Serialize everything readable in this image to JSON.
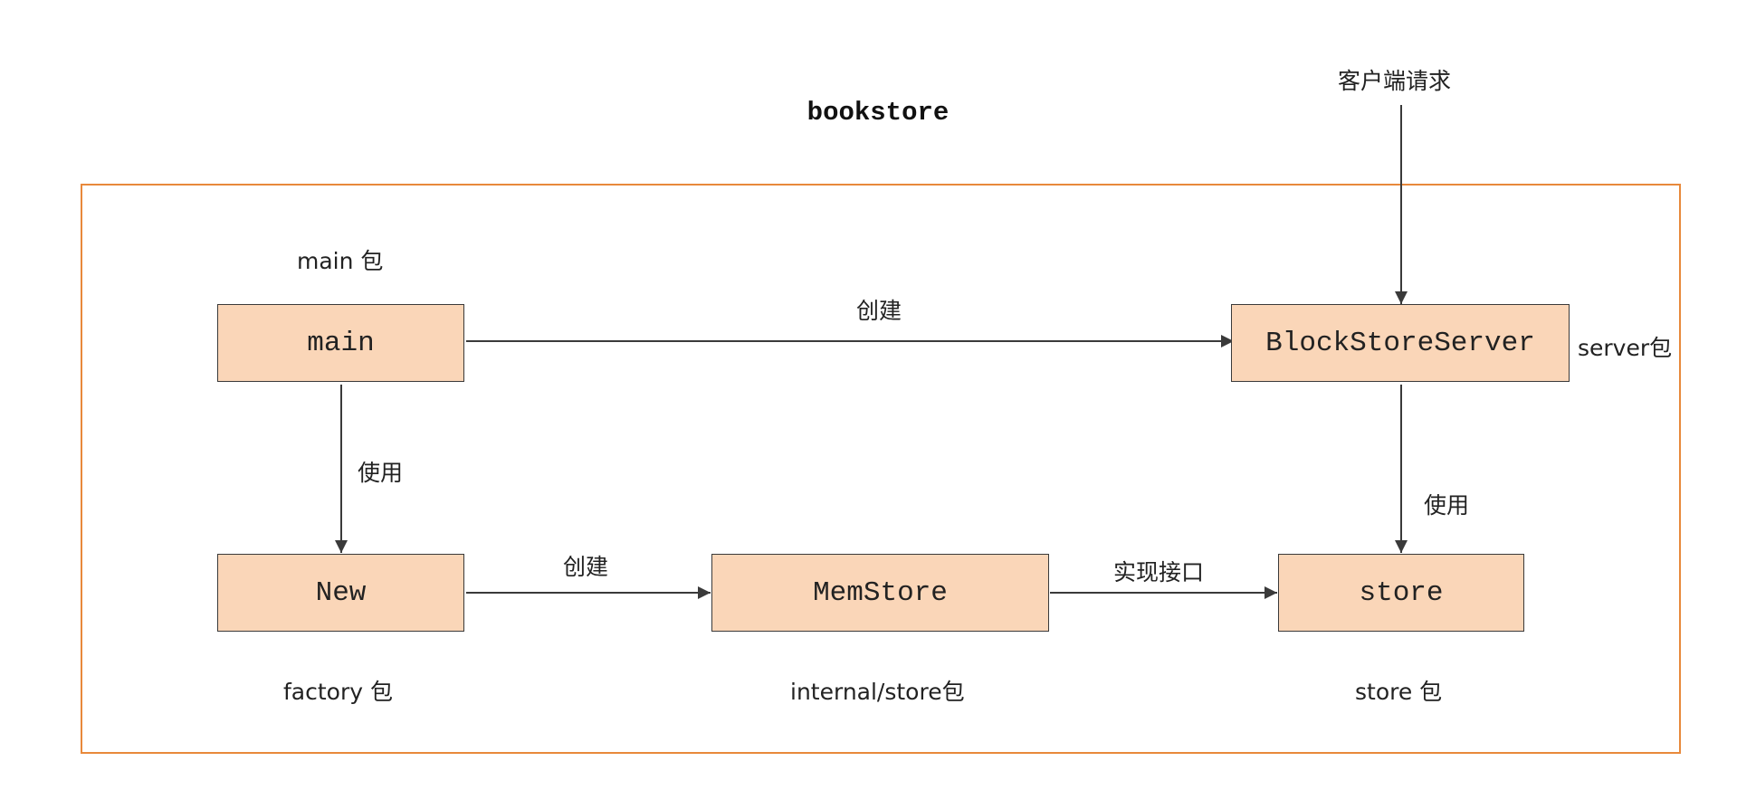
{
  "title": "bookstore",
  "client_request": "客户端请求",
  "nodes": {
    "main": "main",
    "server": "BlockStoreServer",
    "new": "New",
    "memstore": "MemStore",
    "store": "store"
  },
  "packages": {
    "main_pkg": "main 包",
    "server_pkg": "server包",
    "factory_pkg": "factory 包",
    "internal_pkg": "internal/store包",
    "store_pkg": "store 包"
  },
  "edges": {
    "main_to_server": "创建",
    "main_to_new": "使用",
    "new_to_memstore": "创建",
    "memstore_to_store": "实现接口",
    "server_to_store": "使用"
  },
  "colors": {
    "frame": "#e8893b",
    "box_fill": "#fad6b8",
    "line": "#3a3a3a"
  }
}
